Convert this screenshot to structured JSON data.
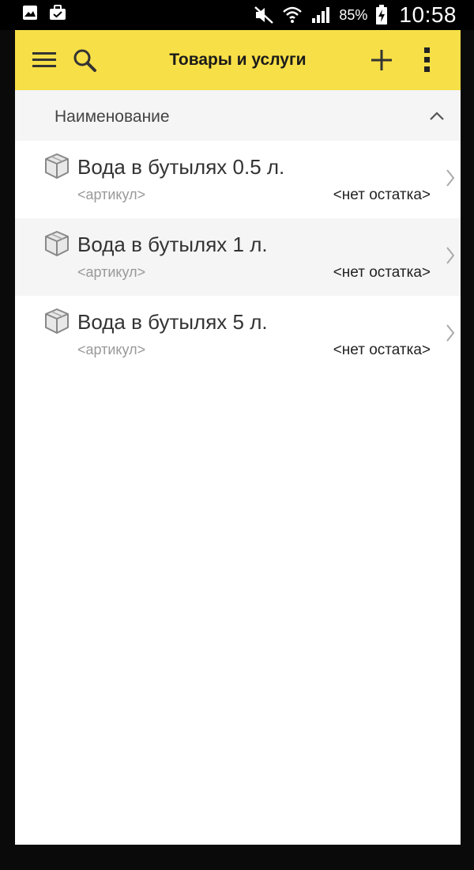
{
  "status_bar": {
    "battery_percent": "85%",
    "time": "10:58"
  },
  "toolbar": {
    "title": "Товары и услуги"
  },
  "column_header": {
    "label": "Наименование"
  },
  "items": [
    {
      "name": "Вода в бутылях 0.5 л.",
      "sku": "<артикул>",
      "stock": "<нет остатка>"
    },
    {
      "name": "Вода в бутылях 1 л.",
      "sku": "<артикул>",
      "stock": "<нет остатка>"
    },
    {
      "name": "Вода в бутылях 5 л.",
      "sku": "<артикул>",
      "stock": "<нет остатка>"
    }
  ],
  "icons": {
    "menu": "menu-icon",
    "search": "search-icon",
    "add": "plus-icon",
    "more": "more-vertical-icon",
    "sort": "chevron-up-icon",
    "item": "box-icon",
    "row_nav": "chevron-right-icon"
  },
  "colors": {
    "toolbar_bg": "#f7df47",
    "header_bg": "#f5f5f5",
    "alt_row_bg": "#f5f5f5"
  }
}
